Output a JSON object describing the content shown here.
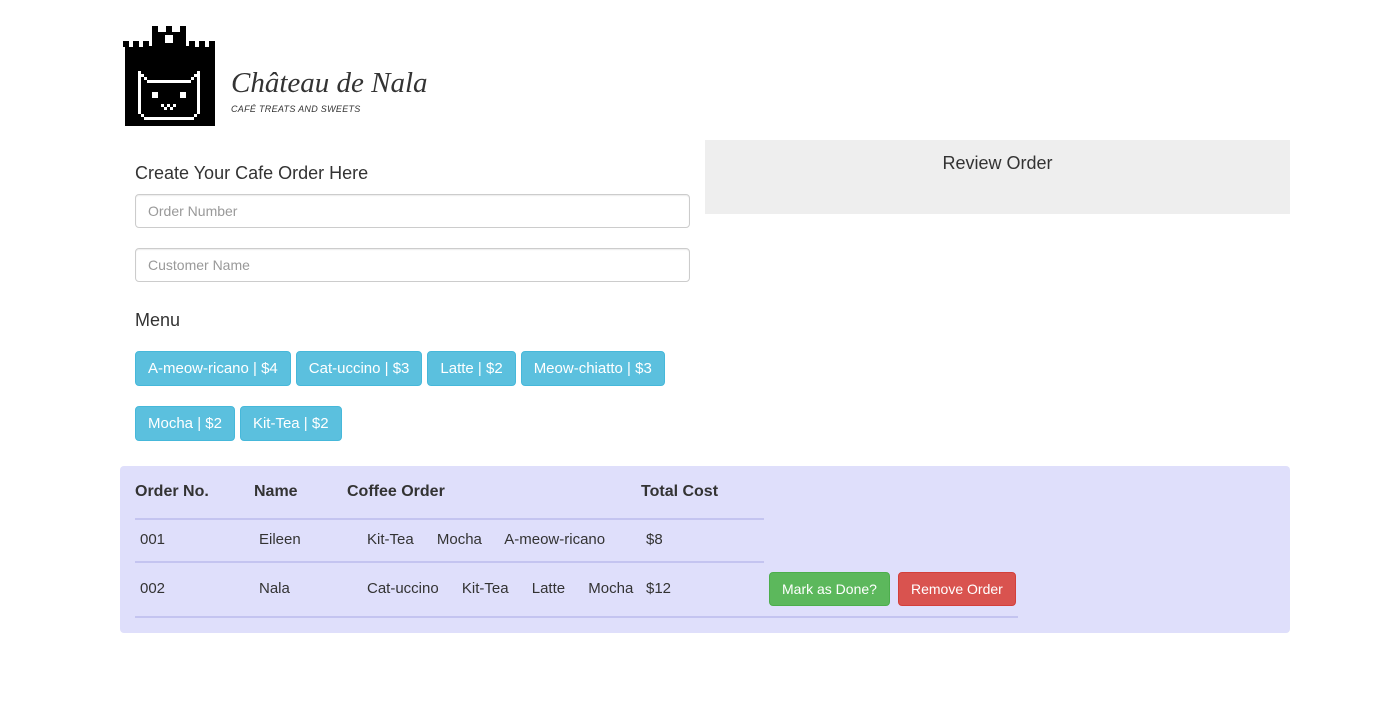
{
  "brand": {
    "title": "Château de Nala",
    "subtitle": "CAFÉ TREATS AND SWEETS",
    "logo_icon": "castle-cat-icon"
  },
  "create": {
    "title": "Create Your Cafe Order Here",
    "order_number_placeholder": "Order Number",
    "customer_name_placeholder": "Customer Name"
  },
  "menu": {
    "title": "Menu",
    "items": [
      "A-meow-ricano | $4",
      "Cat-uccino | $3",
      "Latte | $2",
      "Meow-chiatto | $3",
      "Mocha | $2",
      "Kit-Tea | $2"
    ]
  },
  "review": {
    "title": "Review Order"
  },
  "orders": {
    "headers": [
      "Order No.",
      "Name",
      "Coffee Order",
      "Total Cost"
    ],
    "rows": [
      {
        "number": "001",
        "name": "Eileen",
        "items": [
          "Kit-Tea",
          "Mocha",
          "A-meow-ricano"
        ],
        "total": "$8"
      },
      {
        "number": "002",
        "name": "Nala",
        "items": [
          "Cat-uccino",
          "Kit-Tea",
          "Latte",
          "Mocha"
        ],
        "total": "$12"
      }
    ],
    "done_label": "Mark as Done?",
    "remove_label": "Remove Order"
  },
  "colors": {
    "menu_button": "#5bc0de",
    "done_button": "#5cb85c",
    "remove_button": "#d9534f",
    "orders_panel": "#dfdffb",
    "review_panel": "#eeeeee"
  }
}
